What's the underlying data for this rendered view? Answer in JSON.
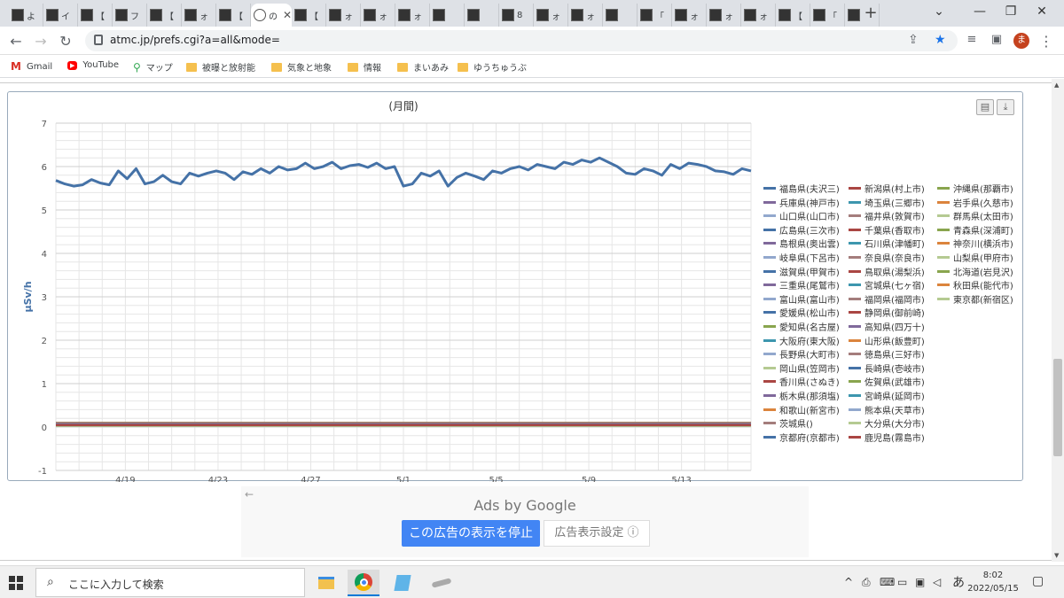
{
  "tabs": [
    {
      "label": "よ"
    },
    {
      "label": "イ"
    },
    {
      "label": "【"
    },
    {
      "label": "フ"
    },
    {
      "label": "【"
    },
    {
      "label": "ォ"
    },
    {
      "label": "【"
    },
    {
      "label": "の",
      "active": true
    },
    {
      "label": "【"
    },
    {
      "label": "ォ"
    },
    {
      "label": "ォ"
    },
    {
      "label": "ォ"
    },
    {
      "label": ""
    },
    {
      "label": ""
    },
    {
      "label": "8"
    },
    {
      "label": "ォ"
    },
    {
      "label": "ォ"
    },
    {
      "label": ""
    },
    {
      "label": "「"
    },
    {
      "label": "ォ"
    },
    {
      "label": "ォ"
    },
    {
      "label": "ォ"
    },
    {
      "label": "【"
    },
    {
      "label": "「"
    },
    {
      "label": ""
    }
  ],
  "newtab": "+",
  "address": {
    "url": "atmc.jp/prefs.cgi?a=all&mode="
  },
  "profile_initial": "ま",
  "bookmarks": [
    {
      "label": "Gmail",
      "icon": "gmail-icon"
    },
    {
      "label": "YouTube",
      "icon": "youtube-icon"
    },
    {
      "label": "マップ",
      "icon": "maps-icon"
    },
    {
      "label": "被曝と放射能",
      "icon": "folder-icon"
    },
    {
      "label": "気象と地象",
      "icon": "folder-icon"
    },
    {
      "label": "情報",
      "icon": "folder-icon"
    },
    {
      "label": "まいあみ",
      "icon": "folder-icon"
    },
    {
      "label": "ゆうちゅうぶ",
      "icon": "folder-icon"
    }
  ],
  "chart_data": {
    "type": "line",
    "title": "(月間)",
    "ylabel": "μSv/h",
    "ylim": [
      -1,
      7
    ],
    "yticks": [
      -1,
      0,
      1,
      2,
      3,
      4,
      5,
      6,
      7
    ],
    "xtick_labels": [
      "4/19",
      "4/23",
      "4/27",
      "5/1",
      "5/5",
      "5/9",
      "5/13"
    ],
    "xtick_days": [
      3,
      7,
      11,
      15,
      19,
      23,
      27
    ],
    "xrange_days": [
      0,
      30
    ],
    "grid": true,
    "legend_position": "right",
    "series": [
      {
        "name": "福島県(夫沢三)",
        "color": "#4572a7",
        "values": [
          5.68,
          5.6,
          5.55,
          5.58,
          5.7,
          5.62,
          5.58,
          5.9,
          5.72,
          5.95,
          5.6,
          5.65,
          5.8,
          5.65,
          5.6,
          5.85,
          5.78,
          5.85,
          5.9,
          5.85,
          5.7,
          5.88,
          5.82,
          5.95,
          5.85,
          6.0,
          5.92,
          5.95,
          6.08,
          5.95,
          6.0,
          6.1,
          5.95,
          6.02,
          6.05,
          5.98,
          6.08,
          5.95,
          6.0,
          5.55,
          5.6,
          5.85,
          5.78,
          5.9,
          5.55,
          5.75,
          5.85,
          5.78,
          5.7,
          5.9,
          5.85,
          5.95,
          6.0,
          5.92,
          6.05,
          6.0,
          5.95,
          6.1,
          6.05,
          6.15,
          6.1,
          6.2,
          6.1,
          6.0,
          5.85,
          5.82,
          5.95,
          5.9,
          5.8,
          6.05,
          5.95,
          6.08,
          6.05,
          6.0,
          5.9,
          5.88,
          5.82,
          5.95,
          5.9
        ]
      },
      {
        "name": "新潟県(村上市)",
        "color": "#aa4643",
        "values": [
          0.1
        ]
      },
      {
        "name": "沖縄県(那覇市)",
        "color": "#89a54e",
        "values": [
          0.09
        ]
      },
      {
        "name": "兵庫県(神戸市)",
        "color": "#80699b",
        "values": [
          0.08
        ]
      },
      {
        "name": "埼玉県(三郷市)",
        "color": "#3d96ae",
        "values": [
          0.07
        ]
      },
      {
        "name": "岩手県(久慈市)",
        "color": "#db843d",
        "values": [
          0.06
        ]
      },
      {
        "name": "山口県(山口市)",
        "color": "#92a8cd",
        "values": [
          0.08
        ]
      },
      {
        "name": "福井県(敦賀市)",
        "color": "#a47d7c",
        "values": [
          0.07
        ]
      },
      {
        "name": "群馬県(太田市)",
        "color": "#b5ca92",
        "values": [
          0.06
        ]
      },
      {
        "name": "広島県(三次市)",
        "color": "#4572a7",
        "values": [
          0.05
        ]
      },
      {
        "name": "千葉県(香取市)",
        "color": "#aa4643",
        "values": [
          0.06
        ]
      },
      {
        "name": "青森県(深浦町)",
        "color": "#89a54e",
        "values": [
          0.05
        ]
      },
      {
        "name": "島根県(奥出雲)",
        "color": "#80699b",
        "values": [
          0.07
        ]
      },
      {
        "name": "石川県(津幡町)",
        "color": "#3d96ae",
        "values": [
          0.05
        ]
      },
      {
        "name": "神奈川(横浜市)",
        "color": "#db843d",
        "values": [
          0.04
        ]
      },
      {
        "name": "岐阜県(下呂市)",
        "color": "#92a8cd",
        "values": [
          0.08
        ]
      },
      {
        "name": "奈良県(奈良市)",
        "color": "#a47d7c",
        "values": [
          0.06
        ]
      },
      {
        "name": "山梨県(甲府市)",
        "color": "#b5ca92",
        "values": [
          0.05
        ]
      },
      {
        "name": "滋賀県(甲賀市)",
        "color": "#4572a7",
        "values": [
          0.07
        ]
      },
      {
        "name": "鳥取県(湯梨浜)",
        "color": "#aa4643",
        "values": [
          0.06
        ]
      },
      {
        "name": "北海道(岩見沢)",
        "color": "#89a54e",
        "values": [
          0.03
        ]
      },
      {
        "name": "三重県(尾鷲市)",
        "color": "#80699b",
        "values": [
          0.05
        ]
      },
      {
        "name": "宮城県(七ヶ宿)",
        "color": "#3d96ae",
        "values": [
          0.04
        ]
      },
      {
        "name": "秋田県(能代市)",
        "color": "#db843d",
        "values": [
          0.04
        ]
      },
      {
        "name": "富山県(富山市)",
        "color": "#92a8cd",
        "values": [
          0.05
        ]
      },
      {
        "name": "福岡県(福岡市)",
        "color": "#a47d7c",
        "values": [
          0.04
        ]
      },
      {
        "name": "東京都(新宿区)",
        "color": "#b5ca92",
        "values": [
          0.04
        ]
      },
      {
        "name": "愛媛県(松山市)",
        "color": "#4572a7",
        "values": [
          0.06
        ]
      },
      {
        "name": "静岡県(御前崎)",
        "color": "#aa4643",
        "values": [
          0.05
        ]
      },
      {
        "name": "愛知県(名古屋)",
        "color": "#89a54e",
        "values": [
          0.05
        ]
      },
      {
        "name": "高知県(四万十)",
        "color": "#80699b",
        "values": [
          0.04
        ]
      },
      {
        "name": "大阪府(東大阪)",
        "color": "#3d96ae",
        "values": [
          0.06
        ]
      },
      {
        "name": "山形県(飯豊町)",
        "color": "#db843d",
        "values": [
          0.05
        ]
      },
      {
        "name": "長野県(大町市)",
        "color": "#92a8cd",
        "values": [
          0.06
        ]
      },
      {
        "name": "徳島県(三好市)",
        "color": "#a47d7c",
        "values": [
          0.05
        ]
      },
      {
        "name": "岡山県(笠岡市)",
        "color": "#b5ca92",
        "values": [
          0.05
        ]
      },
      {
        "name": "長崎県(壱岐市)",
        "color": "#4572a7",
        "values": [
          0.04
        ]
      },
      {
        "name": "香川県(さぬき)",
        "color": "#aa4643",
        "values": [
          0.07
        ]
      },
      {
        "name": "佐賀県(武雄市)",
        "color": "#89a54e",
        "values": [
          0.04
        ]
      },
      {
        "name": "栃木県(那須塩)",
        "color": "#80699b",
        "values": [
          0.05
        ]
      },
      {
        "name": "宮崎県(延岡市)",
        "color": "#3d96ae",
        "values": [
          0.04
        ]
      },
      {
        "name": "和歌山(新宮市)",
        "color": "#db843d",
        "values": [
          0.04
        ]
      },
      {
        "name": "熊本県(天草市)",
        "color": "#92a8cd",
        "values": [
          0.04
        ]
      },
      {
        "name": "茨城県()",
        "color": "#a47d7c",
        "values": [
          0.05
        ]
      },
      {
        "name": "大分県(大分市)",
        "color": "#b5ca92",
        "values": [
          0.04
        ]
      },
      {
        "name": "京都府(京都市)",
        "color": "#4572a7",
        "values": [
          0.05
        ]
      },
      {
        "name": "鹿児島(霧島市)",
        "color": "#aa4643",
        "values": [
          0.04
        ]
      }
    ]
  },
  "ads": {
    "by_label": "Ads by Google",
    "stop_label": "この広告の表示を停止",
    "settings_label": "広告表示設定 ⓘ"
  },
  "taskbar": {
    "search_placeholder": "ここに入力して検索",
    "time": "8:02",
    "date": "2022/05/15",
    "ime": "あ"
  }
}
